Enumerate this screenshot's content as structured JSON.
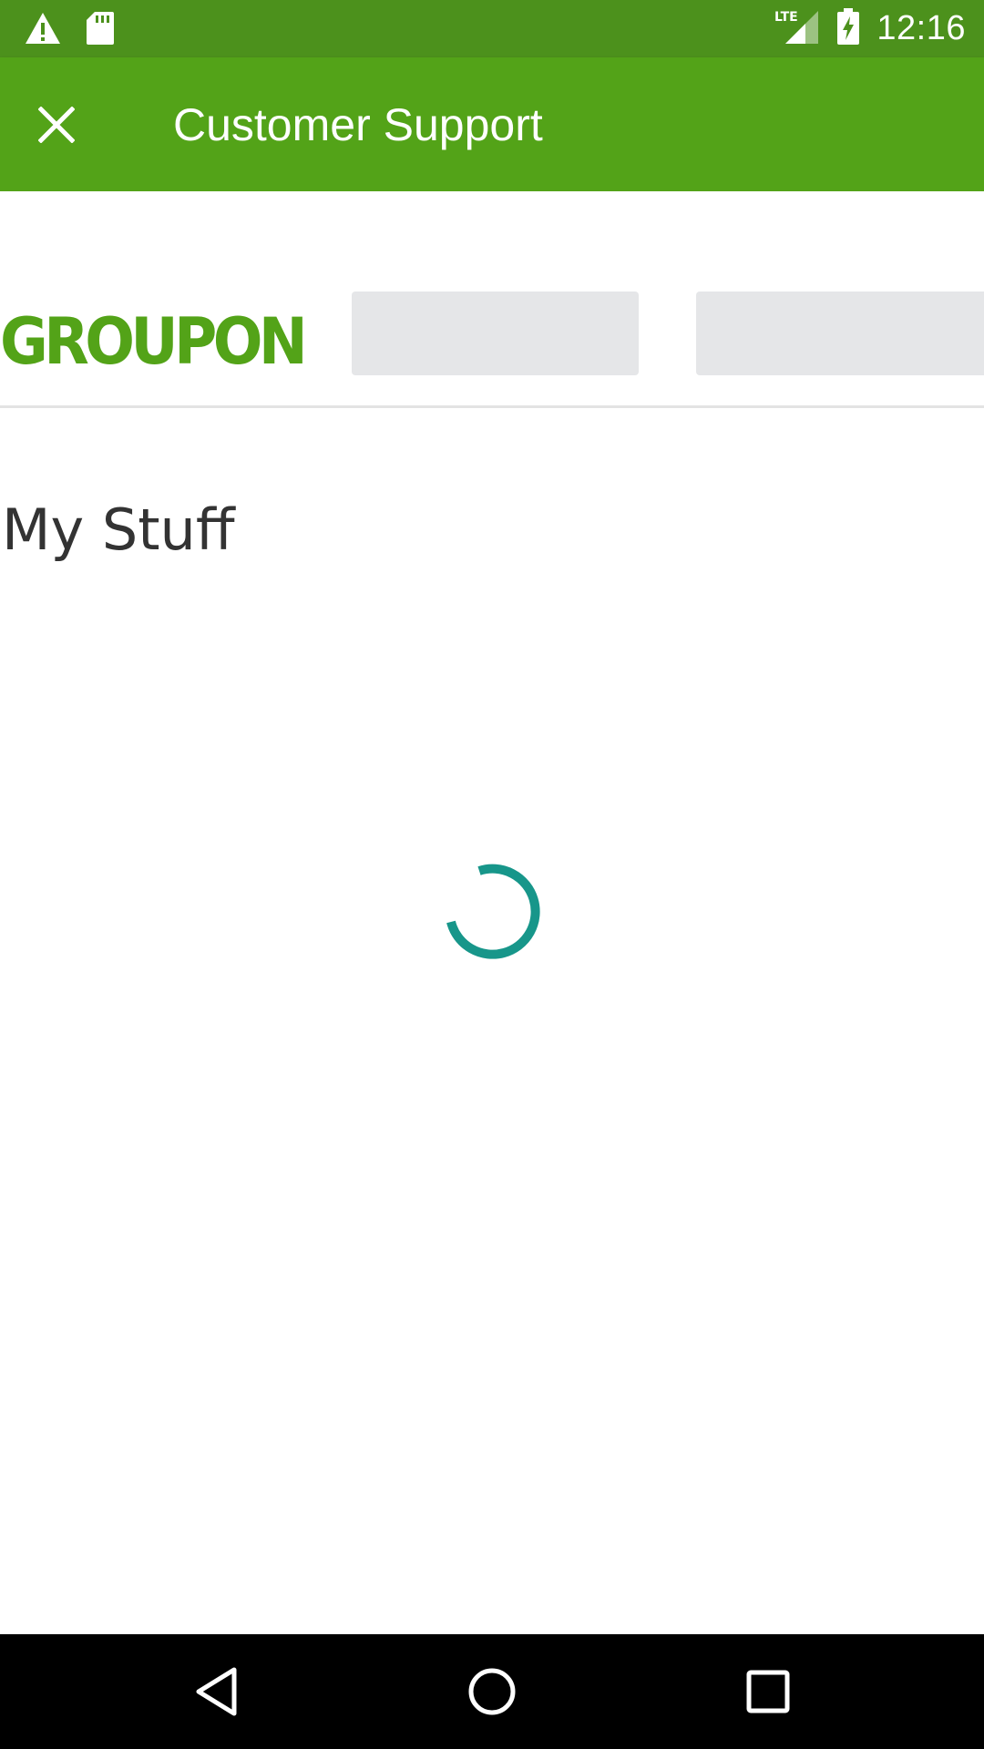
{
  "status_bar": {
    "time": "12:16",
    "network_label": "LTE",
    "icons": [
      "warning-icon",
      "sd-card-icon",
      "lte-signal-icon",
      "battery-charging-icon"
    ]
  },
  "app_bar": {
    "title": "Customer Support",
    "close_icon": "close-icon"
  },
  "header": {
    "logo_text": "GROUPON",
    "placeholders": 2
  },
  "main": {
    "page_title": "My Stuff",
    "loading": true
  },
  "nav_bar": {
    "icons": [
      "back-icon",
      "home-icon",
      "recents-icon"
    ]
  },
  "colors": {
    "status_bar": "#4c911c",
    "app_bar": "#53a318",
    "brand_green": "#53a318",
    "spinner": "#17968a",
    "placeholder": "#e5e6e8",
    "title_text": "#333333"
  }
}
